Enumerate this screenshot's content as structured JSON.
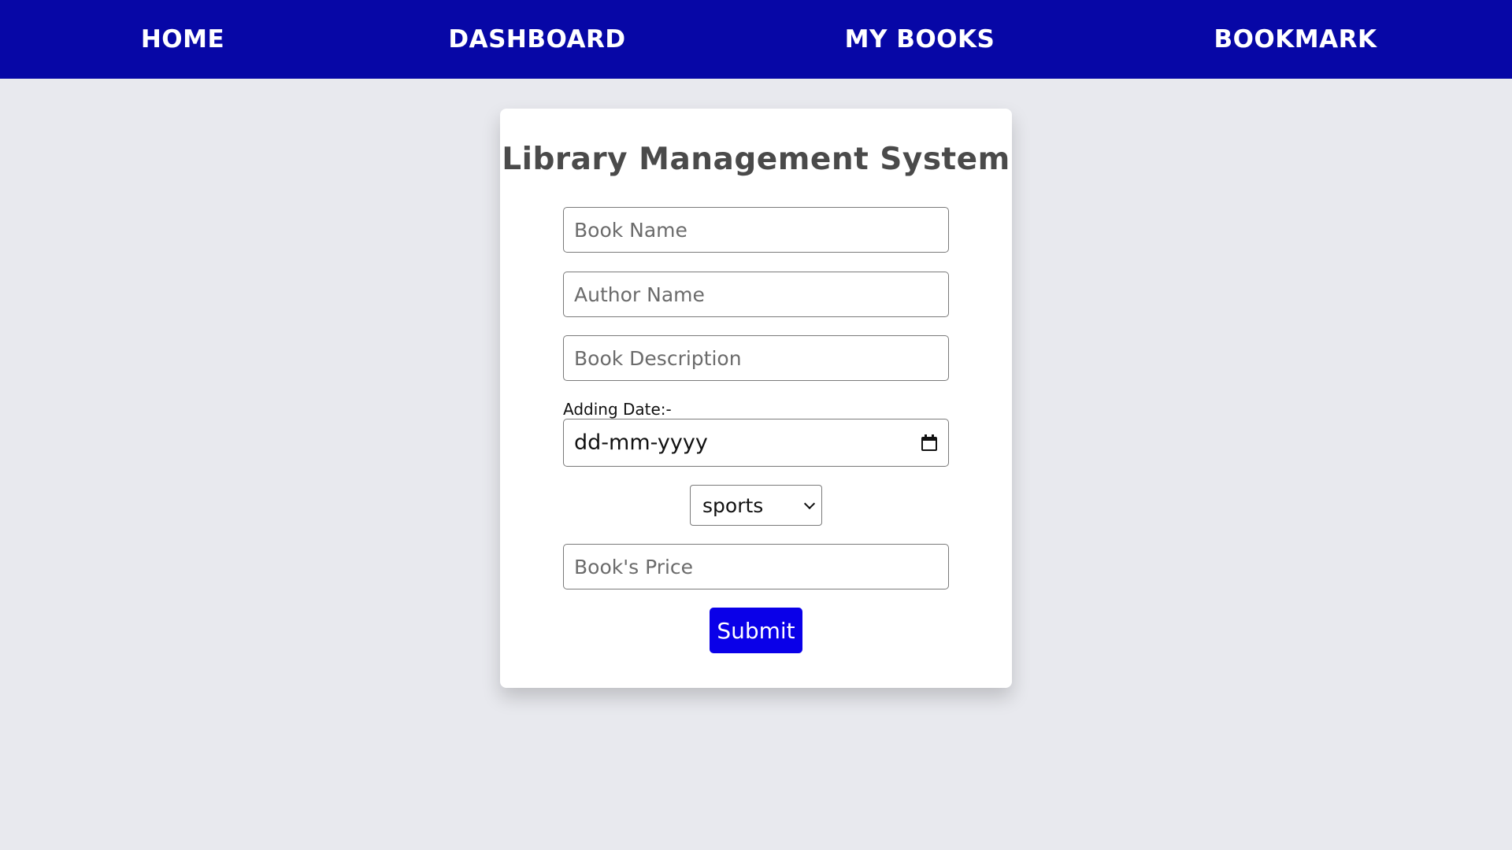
{
  "nav": {
    "items": [
      {
        "label": "HOME"
      },
      {
        "label": "DASHBOARD"
      },
      {
        "label": "MY BOOKS"
      },
      {
        "label": "BOOKMARK"
      }
    ]
  },
  "form": {
    "title": "Library Management System",
    "book_name": {
      "placeholder": "Book Name",
      "value": ""
    },
    "author_name": {
      "placeholder": "Author Name",
      "value": ""
    },
    "book_description": {
      "placeholder": "Book Description",
      "value": ""
    },
    "adding_date": {
      "label": "Adding Date:-",
      "value": "dd-mm-yyyy",
      "icon": "calendar-icon"
    },
    "category": {
      "selected": "sports",
      "icon": "chevron-down-icon"
    },
    "book_price": {
      "placeholder": "Book's Price",
      "value": ""
    },
    "submit_label": "Submit"
  },
  "colors": {
    "navbar": "#0707a6",
    "background": "#e8e9ee",
    "submit": "#0a00e8",
    "title": "#4a4a4a"
  }
}
